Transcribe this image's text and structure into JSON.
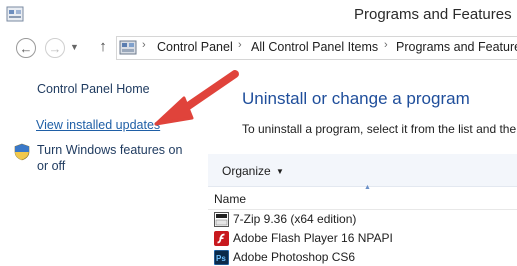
{
  "window": {
    "title": "Programs and Features"
  },
  "address_bar": {
    "crumbs": [
      "Control Panel",
      "All Control Panel Items",
      "Programs and Features"
    ]
  },
  "sidebar": {
    "home": "Control Panel Home",
    "view_updates": "View installed updates",
    "windows_features": "Turn Windows features on or off"
  },
  "main": {
    "heading": "Uninstall or change a program",
    "description": "To uninstall a program, select it from the list and the",
    "toolbar": {
      "organize": "Organize"
    },
    "column_name": "Name",
    "programs": [
      {
        "name": "7-Zip 9.36 (x64 edition)",
        "icon": "7zip-icon"
      },
      {
        "name": "Adobe Flash Player 16 NPAPI",
        "icon": "flash-icon"
      },
      {
        "name": "Adobe Photoshop CS6",
        "icon": "photoshop-icon"
      }
    ]
  },
  "colors": {
    "link": "#1f5fa6",
    "heading": "#1f4e9b",
    "arrow": "#e0433b"
  }
}
